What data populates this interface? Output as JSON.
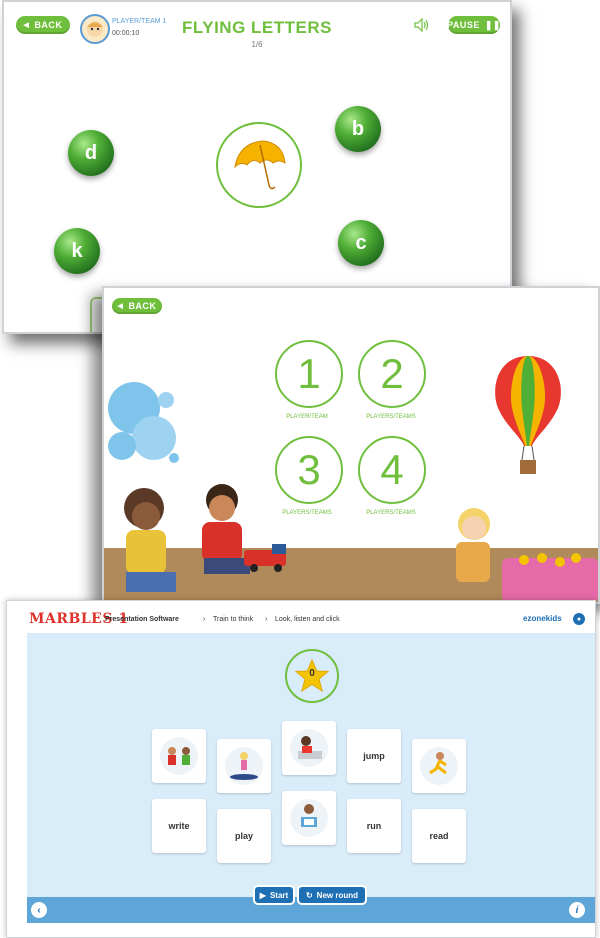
{
  "flying_letters": {
    "back_label": "BACK",
    "player_name": "PLAYER/TEAM 1",
    "timer": "00:00:10",
    "title": "FLYING LETTERS",
    "progress": "1/6",
    "pause_label": "PAUSE",
    "letters": [
      "d",
      "b",
      "k",
      "c"
    ],
    "target_image_icon": "umbrella-icon",
    "colors": {
      "accent": "#6fbf3d"
    }
  },
  "player_select": {
    "back_label": "BACK",
    "options": [
      {
        "number": "1",
        "label": "PLAYER/TEAM"
      },
      {
        "number": "2",
        "label": "PLAYERS/TEAMS"
      },
      {
        "number": "3",
        "label": "PLAYERS/TEAMS"
      },
      {
        "number": "4",
        "label": "PLAYERS/TEAMS"
      }
    ]
  },
  "marbles": {
    "logo": "MARBLES 1",
    "breadcrumb": [
      "Presentation Software",
      "Train to think",
      "Look, listen and click"
    ],
    "brand": "ezonekids",
    "score": "0",
    "cards_row1": [
      "",
      "",
      "",
      "jump",
      ""
    ],
    "cards_row2": [
      "write",
      "play",
      "",
      "run",
      "read"
    ],
    "start_label": "Start",
    "new_round_label": "New round",
    "colors": {
      "stage": "#d9ecf9",
      "button": "#1f6fb5",
      "logo": "#e0312a"
    }
  }
}
